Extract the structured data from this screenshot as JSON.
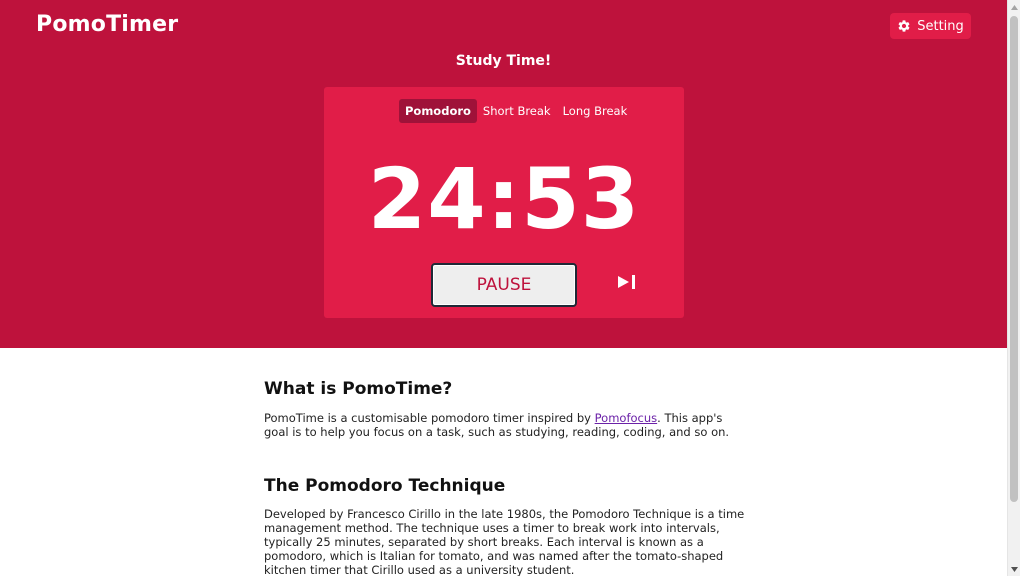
{
  "header": {
    "brand": "PomoTimer",
    "setting_label": "Setting",
    "setting_icon": "gear-icon"
  },
  "timer": {
    "mode_title": "Study Time!",
    "tabs": [
      {
        "label": "Pomodoro",
        "active": true
      },
      {
        "label": "Short Break",
        "active": false
      },
      {
        "label": "Long Break",
        "active": false
      }
    ],
    "time": "24:53",
    "pause_label": "PAUSE",
    "skip_icon": "skip-next-icon"
  },
  "about": {
    "heading": "What is PomoTime?",
    "text_before_link": "PomoTime is a customisable pomodoro timer inspired by ",
    "link_text": "Pomofocus",
    "text_after_link": ". This app's goal is to help you focus on a task, such as studying, reading, coding, and so on."
  },
  "technique": {
    "heading": "The Pomodoro Technique",
    "text": "Developed by Francesco Cirillo in the late 1980s, the Pomodoro Technique is a time management method. The technique uses a timer to break work into intervals, typically 25 minutes, separated by short breaks. Each interval is known as a pomodoro, which is Italian for tomato, and was named after the tomato-shaped kitchen timer that Cirillo used as a university student."
  },
  "colors": {
    "hero_background": "#be123c",
    "card_background": "#e11d48",
    "active_tab": "#9f1239",
    "pause_text": "#be123c",
    "link": "#6b21a8"
  }
}
